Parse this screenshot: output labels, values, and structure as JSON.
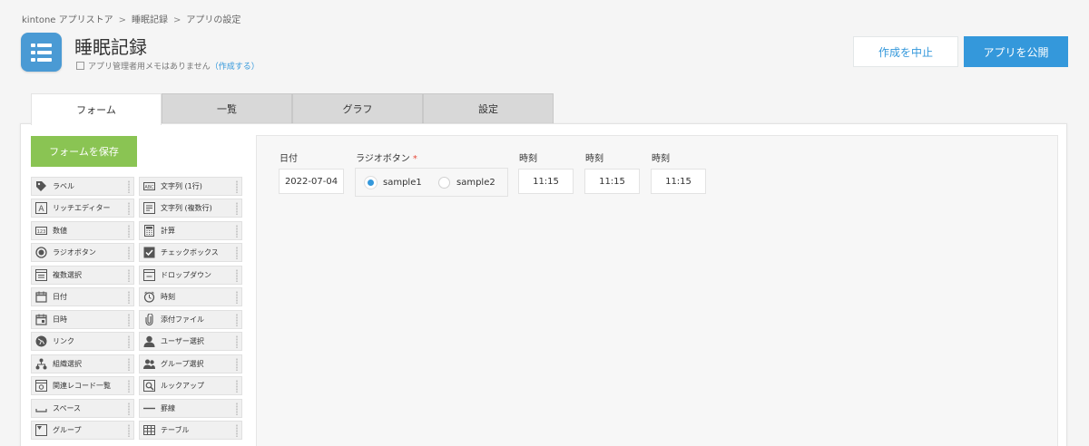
{
  "breadcrumb": [
    "kintone アプリストア",
    "睡眠記録",
    "アプリの設定"
  ],
  "app": {
    "title": "睡眠記録",
    "memo_text": "アプリ管理者用メモはありません",
    "memo_link": "（作成する）"
  },
  "actions": {
    "cancel": "作成を中止",
    "publish": "アプリを公開"
  },
  "tabs": [
    "フォーム",
    "一覧",
    "グラフ",
    "設定"
  ],
  "save_form": "フォームを保存",
  "palette": [
    {
      "label": "ラベル",
      "icon": "tag-icon"
    },
    {
      "label": "文字列 (1行)",
      "icon": "abc-icon"
    },
    {
      "label": "リッチエディター",
      "icon": "rich-editor-icon"
    },
    {
      "label": "文字列 (複数行)",
      "icon": "multiline-icon"
    },
    {
      "label": "数値",
      "icon": "number-icon"
    },
    {
      "label": "計算",
      "icon": "calculator-icon"
    },
    {
      "label": "ラジオボタン",
      "icon": "radio-icon"
    },
    {
      "label": "チェックボックス",
      "icon": "checkbox-icon"
    },
    {
      "label": "複数選択",
      "icon": "multi-select-icon"
    },
    {
      "label": "ドロップダウン",
      "icon": "dropdown-icon"
    },
    {
      "label": "日付",
      "icon": "calendar-icon"
    },
    {
      "label": "時刻",
      "icon": "clock-icon"
    },
    {
      "label": "日時",
      "icon": "datetime-icon"
    },
    {
      "label": "添付ファイル",
      "icon": "paperclip-icon"
    },
    {
      "label": "リンク",
      "icon": "globe-icon"
    },
    {
      "label": "ユーザー選択",
      "icon": "user-icon"
    },
    {
      "label": "組織選択",
      "icon": "org-icon"
    },
    {
      "label": "グループ選択",
      "icon": "group-icon"
    },
    {
      "label": "関連レコード一覧",
      "icon": "related-records-icon"
    },
    {
      "label": "ルックアップ",
      "icon": "lookup-icon"
    },
    {
      "label": "スペース",
      "icon": "space-icon"
    },
    {
      "label": "罫線",
      "icon": "hr-icon"
    },
    {
      "label": "グループ",
      "icon": "group-field-icon"
    },
    {
      "label": "テーブル",
      "icon": "table-icon"
    }
  ],
  "form": {
    "date_label": "日付",
    "date_value": "2022-07-04",
    "radio_label": "ラジオボタン",
    "required_mark": "*",
    "radio_options": [
      "sample1",
      "sample2"
    ],
    "radio_selected": "sample1",
    "time_fields": [
      {
        "label": "時刻",
        "value": "11:15"
      },
      {
        "label": "時刻",
        "value": "11:15"
      },
      {
        "label": "時刻",
        "value": "11:15"
      }
    ]
  },
  "colors": {
    "accent": "#3498db",
    "save_green": "#8ac453",
    "required": "#e74c3c"
  }
}
